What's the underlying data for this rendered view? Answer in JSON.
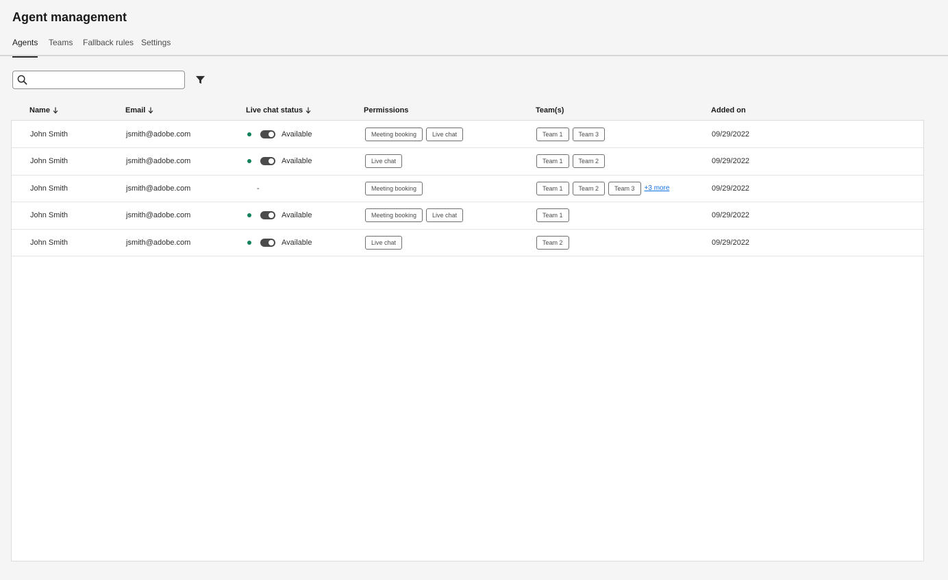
{
  "page": {
    "title": "Agent management"
  },
  "tabs": [
    {
      "label": "Agents",
      "active": true
    },
    {
      "label": "Teams",
      "active": false
    },
    {
      "label": "Fallback rules",
      "active": false
    },
    {
      "label": "Settings",
      "active": false
    }
  ],
  "search": {
    "value": "",
    "placeholder": ""
  },
  "icons": {
    "search": "search-icon",
    "filter": "filter-icon",
    "sort": "sort-arrow-down-icon"
  },
  "colors": {
    "available": "#12805c",
    "toggle_on": "#4b4b4b",
    "link": "#1473e6"
  },
  "table": {
    "columns": {
      "name": "Name",
      "email": "Email",
      "status": "Live chat status",
      "permissions": "Permissions",
      "teams": "Team(s)",
      "added_on": "Added on"
    },
    "rows": [
      {
        "name": "John Smith",
        "email": "jsmith@adobe.com",
        "status": "Available",
        "live_chat_enabled": true,
        "permissions": [
          "Meeting booking",
          "Live chat"
        ],
        "teams": [
          "Team 1",
          "Team 3"
        ],
        "more": "",
        "added_on": "09/29/2022"
      },
      {
        "name": "John Smith",
        "email": "jsmith@adobe.com",
        "status": "Available",
        "live_chat_enabled": true,
        "permissions": [
          "Live chat"
        ],
        "teams": [
          "Team 1",
          "Team 2"
        ],
        "more": "",
        "added_on": "09/29/2022"
      },
      {
        "name": "John Smith",
        "email": "jsmith@adobe.com",
        "status": "-",
        "live_chat_enabled": false,
        "permissions": [
          "Meeting booking"
        ],
        "teams": [
          "Team 1",
          "Team 2",
          "Team 3"
        ],
        "more": "+3 more",
        "added_on": "09/29/2022"
      },
      {
        "name": "John Smith",
        "email": "jsmith@adobe.com",
        "status": "Available",
        "live_chat_enabled": true,
        "permissions": [
          "Meeting booking",
          "Live chat"
        ],
        "teams": [
          "Team 1"
        ],
        "more": "",
        "added_on": "09/29/2022"
      },
      {
        "name": "John Smith",
        "email": "jsmith@adobe.com",
        "status": "Available",
        "live_chat_enabled": true,
        "permissions": [
          "Live chat"
        ],
        "teams": [
          "Team 2"
        ],
        "more": "",
        "added_on": "09/29/2022"
      }
    ]
  }
}
